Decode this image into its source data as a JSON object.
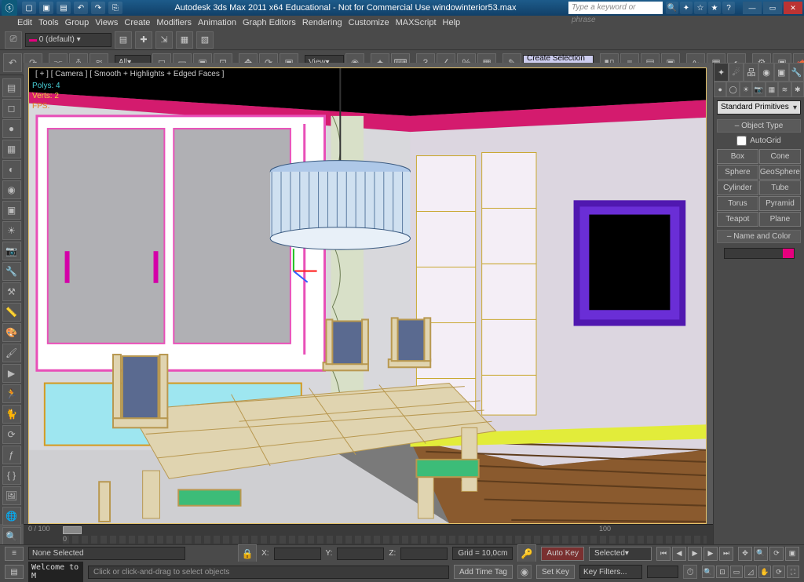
{
  "app": {
    "title": "Autodesk 3ds Max  2011 x64   Educational - Not for Commercial Use   windowinterior53.max",
    "search_placeholder": "Type a keyword or phrase",
    "logo_letter": "ⓢ"
  },
  "menubar": [
    "Edit",
    "Tools",
    "Group",
    "Views",
    "Create",
    "Modifiers",
    "Animation",
    "Graph Editors",
    "Rendering",
    "Customize",
    "MAXScript",
    "Help"
  ],
  "selection_set": "0 (default)",
  "maintb": {
    "all": "All",
    "view": "View",
    "create_sel": "Create Selection Se"
  },
  "viewport": {
    "label": "[ + ] [ Camera ] [ Smooth + Highlights + Edged Faces ]",
    "polys_label": "Polys:",
    "polys_value": "4",
    "verts_label": "Verts:",
    "verts_value": "2",
    "fps_label": "FPS:"
  },
  "command_panel": {
    "dropdown": "Standard Primitives",
    "rollout_objtype": "Object Type",
    "autogrid": "AutoGrid",
    "primitives": [
      [
        "Box",
        "Cone"
      ],
      [
        "Sphere",
        "GeoSphere"
      ],
      [
        "Cylinder",
        "Tube"
      ],
      [
        "Torus",
        "Pyramid"
      ],
      [
        "Teapot",
        "Plane"
      ]
    ],
    "rollout_name": "Name and Color"
  },
  "timeline": {
    "pos": "0 / 100",
    "start": "0",
    "end": "100"
  },
  "status": {
    "selection": "None Selected",
    "x_label": "X:",
    "y_label": "Y:",
    "z_label": "Z:",
    "grid": "Grid = 10,0cm",
    "autokey": "Auto Key",
    "selected": "Selected",
    "setkey": "Set Key",
    "keyfilters": "Key Filters...",
    "mx": "Welcome to M",
    "prompt": "Click or click-and-drag to select objects",
    "addtag": "Add Time Tag"
  }
}
